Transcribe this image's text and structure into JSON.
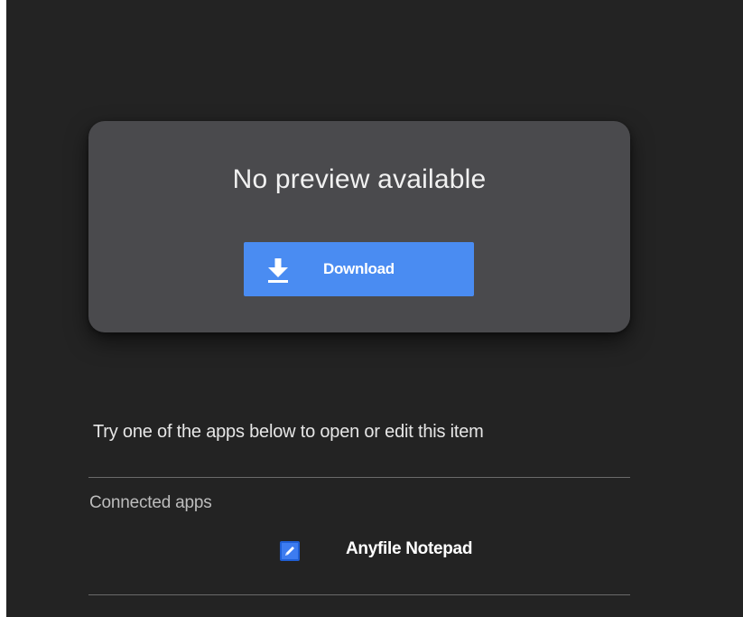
{
  "preview": {
    "message": "No preview available",
    "download_label": "Download",
    "download_icon": "download-arrow-icon"
  },
  "apps_section": {
    "hint": "Try one of the apps below to open or edit this item",
    "heading": "Connected apps",
    "apps": [
      {
        "label": "Anyfile Notepad",
        "icon": "notepad-pencil-icon"
      }
    ]
  },
  "colors": {
    "background": "#232323",
    "card": "#4a4a4d",
    "accent": "#4a8cf2",
    "divider": "#6a6a6a"
  }
}
